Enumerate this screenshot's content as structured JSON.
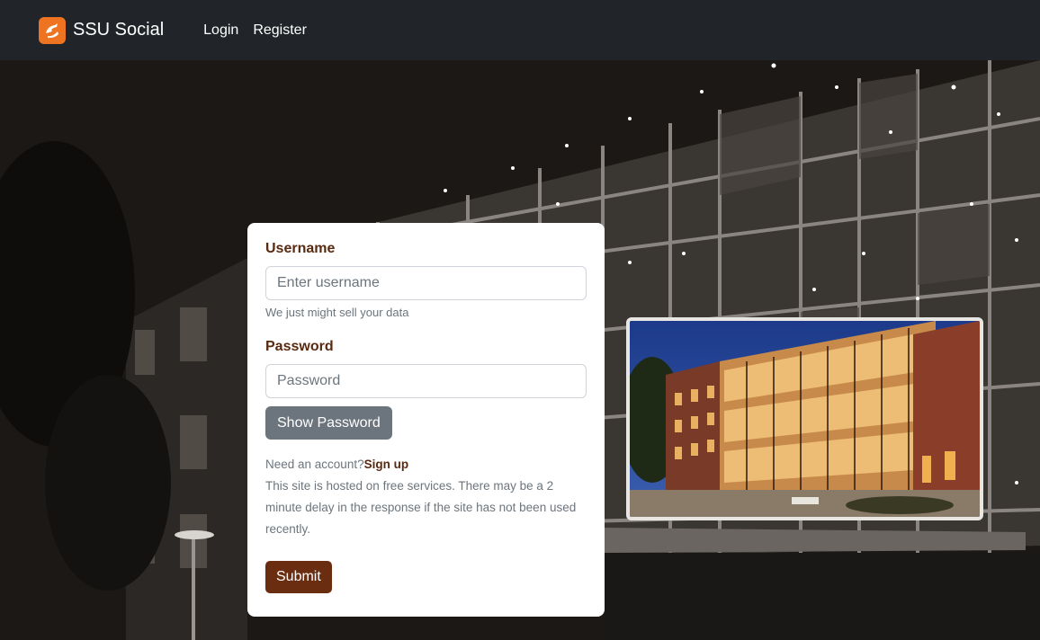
{
  "navbar": {
    "brand": "SSU Social",
    "links": [
      {
        "label": "Login"
      },
      {
        "label": "Register"
      }
    ]
  },
  "login_form": {
    "username_label": "Username",
    "username_placeholder": "Enter username",
    "username_help": "We just might sell your data",
    "password_label": "Password",
    "password_placeholder": "Password",
    "show_password_label": "Show Password",
    "need_account_text": "Need an account?",
    "signup_label": "Sign up",
    "hosting_notice": "This site is hosted on free services. There may be a 2 minute delay in the response if the site has not been used recently.",
    "submit_label": "Submit"
  },
  "colors": {
    "navbar_bg": "#212529",
    "brand_orange": "#ee7421",
    "label_brown": "#5a2a10",
    "submit_brown": "#6b2d10",
    "secondary_gray": "#6c757d"
  },
  "icons": {
    "brand_logo": "ssu-logo-icon"
  }
}
